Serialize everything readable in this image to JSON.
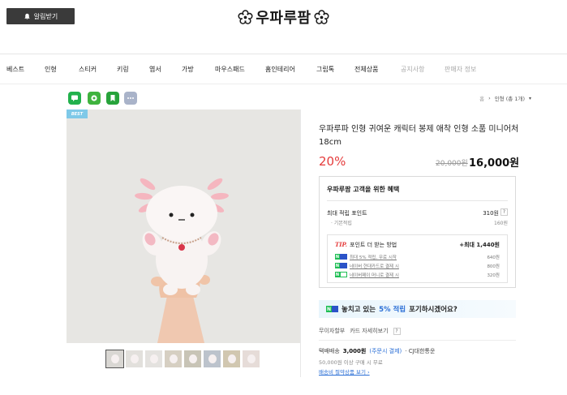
{
  "header": {
    "alarm_label": "알림받기",
    "logo_text": "우파루팜"
  },
  "nav": {
    "items": [
      "베스트",
      "인형",
      "스티커",
      "키링",
      "엽서",
      "가방",
      "마우스패드",
      "홈인테리어",
      "그립톡",
      "전체상품"
    ],
    "muted_items": [
      "공지사항",
      "판매자 정보"
    ]
  },
  "breadcrumb": {
    "home": "홈",
    "current": "인형",
    "count": "(총 1개)"
  },
  "product": {
    "badge": "BEST",
    "title": "우파루파 인형 귀여운 캐릭터 봉제 애착 인형 소품 미니어처 18cm",
    "discount": "20%",
    "original_price": "20,000원",
    "price": "16,000원"
  },
  "benefits": {
    "title": "우파루팜 고객을 위한 혜택",
    "max_point_label": "최대 적립 포인트",
    "max_point_value": "310원",
    "help": "?",
    "base_label": "기본적립",
    "base_value": "160원",
    "tip_label": "TIP.",
    "tip_text": "포인트 더 받는 방법",
    "tip_max": "+최대 1,440원",
    "tip_rows": [
      {
        "text": "최대 5% 적립, 무료 시작",
        "value": "640원"
      },
      {
        "text": "네이버 현대카드로 결제 시",
        "value": "800원"
      },
      {
        "text": "네이버페이 머니로 결제 시",
        "value": "320원"
      }
    ]
  },
  "npay": {
    "text_pre": "놓치고 있는",
    "text_highlight": "5% 적립",
    "text_post": "포기하시겠어요?"
  },
  "payment": {
    "installment": "무이자할부",
    "card_detail": "카드 자세히보기",
    "help": "?"
  },
  "shipping": {
    "label": "택배배송",
    "cost": "3,000원",
    "condition": "(주문시 결제)",
    "carrier": "· CJ대한통운",
    "free_condition": "50,000원 이상 구매 시 무료",
    "link": "배송비 절약상품 보기 ›"
  },
  "colors": {
    "discount": "#e53b3b",
    "npay_green": "#1fbf54",
    "link_blue": "#2b6fd6",
    "best_badge": "#7fc9e8"
  }
}
